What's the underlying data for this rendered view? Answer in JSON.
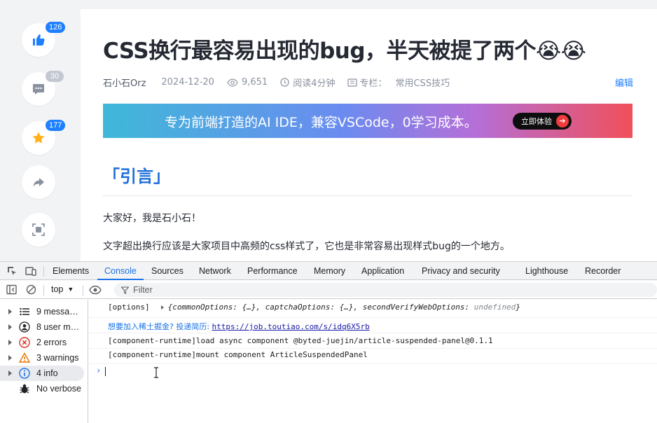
{
  "side_actions": [
    {
      "name": "like",
      "icon": "thumbs-up-icon",
      "count": "126",
      "badge_color": "#1e80ff"
    },
    {
      "name": "comment",
      "icon": "comment-icon",
      "count": "30",
      "badge_color": "#c2c8d1"
    },
    {
      "name": "collect",
      "icon": "star-icon",
      "count": "177",
      "badge_color": "#1e80ff"
    },
    {
      "name": "share",
      "icon": "share-icon"
    },
    {
      "name": "focus",
      "icon": "focus-mode-icon"
    }
  ],
  "article": {
    "title": "CSS换行最容易出现的bug，半天被提了两个😭😭",
    "author": "石小石Orz",
    "date": "2024-12-20",
    "views": "9,651",
    "read_time": "阅读4分钟",
    "column_label": "专栏：",
    "column_name": "常用CSS技巧",
    "edit_label": "编辑",
    "banner_text": "专为前端打造的AI IDE，兼容VSCode，0学习成本。",
    "banner_button": "立即体验",
    "section_heading": "「引言」",
    "paragraphs": [
      "大家好，我是石小石！",
      "文字超出换行应该是大家项目中高频的css样式了，它也是非常容易出现样式bug的一个地方。"
    ]
  },
  "devtools": {
    "tabs": [
      "Elements",
      "Console",
      "Sources",
      "Network",
      "Performance",
      "Memory",
      "Application",
      "Privacy and security",
      "Lighthouse",
      "Recorder"
    ],
    "active_tab": "Console",
    "context": "top",
    "filter_placeholder": "Filter",
    "sidebar": [
      {
        "label": "9 messag…",
        "icon": "list-icon"
      },
      {
        "label": "8 user m…",
        "icon": "user-icon"
      },
      {
        "label": "2 errors",
        "icon": "error-icon"
      },
      {
        "label": "3 warnings",
        "icon": "warning-icon"
      },
      {
        "label": "4 info",
        "icon": "info-icon",
        "selected": true
      },
      {
        "label": "No verbose",
        "icon": "bug-icon"
      }
    ],
    "logs": {
      "options_label": "[options]",
      "options_preview_1": "{commonOptions: {…}, captchaOptions: {…}, secondVerifyWebOptions: ",
      "options_preview_undef": "undefined",
      "options_preview_end": "}",
      "hire_text": "想要加入稀土掘金? 投递简历: ",
      "hire_link": "https://job.toutiao.com/s/idq6X5rb",
      "load_line": "[component-runtime]load async component @byted-juejin/article-suspended-panel@0.1.1",
      "mount_line": "[component-runtime]mount component ArticleSuspendedPanel"
    }
  }
}
